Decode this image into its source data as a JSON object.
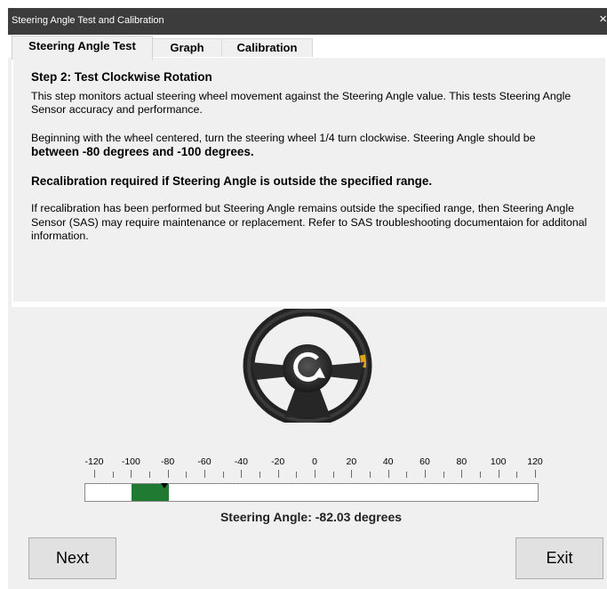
{
  "window": {
    "title": "Steering Angle Test and Calibration",
    "close_glyph": "×"
  },
  "tabs": [
    {
      "label": "Steering Angle Test",
      "active": true
    },
    {
      "label": "Graph",
      "active": false
    },
    {
      "label": "Calibration",
      "active": false
    }
  ],
  "instructions": {
    "step_title": "Step 2: Test Clockwise Rotation",
    "p1": "This step monitors actual steering wheel movement against the Steering Angle value. This tests Steering Angle Sensor accuracy and performance.",
    "p2_lead": "Beginning with the wheel centered, turn the steering wheel 1/4 turn clockwise. Steering Angle should be",
    "p2_bold": "between -80 degrees and -100 degrees.",
    "recal": "Recalibration required if Steering Angle is outside the specified range.",
    "p3": "If recalibration has been performed but Steering Angle remains outside the specified range, then Steering Angle Sensor (SAS) may require maintenance or replacement. Refer to SAS troubleshooting documentaion for additonal information."
  },
  "icons": {
    "wheel": "steering-wheel-icon",
    "rotation": "clockwise-rotation-icon"
  },
  "scale": {
    "min": -120,
    "max": 120,
    "labels": [
      "-120",
      "-100",
      "-80",
      "-60",
      "-40",
      "-20",
      "0",
      "20",
      "40",
      "60",
      "80",
      "100",
      "120"
    ],
    "range_low": -100,
    "range_high": -80,
    "current": -82.03,
    "range_color": "#217a32"
  },
  "readout": {
    "text": "Steering Angle: -82.03 degrees"
  },
  "buttons": {
    "next": "Next",
    "exit": "Exit"
  }
}
